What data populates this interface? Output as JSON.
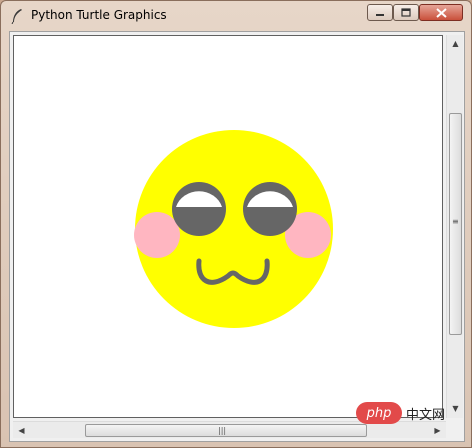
{
  "window": {
    "title": "Python Turtle Graphics",
    "controls": {
      "minimize_icon": "minimize-icon",
      "maximize_icon": "maximize-icon",
      "close_icon": "close-icon"
    }
  },
  "drawing": {
    "face_color": "#ffff00",
    "cheek_color": "#ffb6c1",
    "eye_color": "#666666",
    "eye_white": "#ffffff"
  },
  "scrollbars": {
    "grip_glyph": "≡",
    "hgrip_glyph": "|||"
  },
  "watermark": {
    "badge": "php",
    "text": "中文网"
  }
}
